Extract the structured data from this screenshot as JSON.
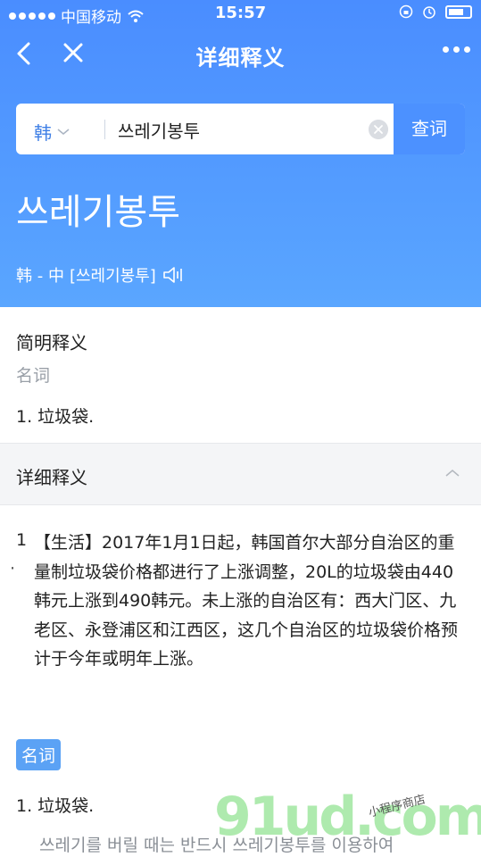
{
  "status_bar": {
    "carrier": "中国移动",
    "time": "15:57"
  },
  "navbar": {
    "title": "详细释义",
    "back_icon": "chevron-left-icon",
    "close_icon": "close-icon",
    "more_icon": "more-dots-icon"
  },
  "search": {
    "language": "韩",
    "query": "쓰레기봉투",
    "button_label": "查词"
  },
  "word": {
    "headword": "쓰레기봉투",
    "direction": "韩 - 中",
    "phonetic": "[쓰레기봉투]"
  },
  "brief": {
    "title": "简明释义",
    "pos": "名词",
    "definition": "1. 垃圾袋."
  },
  "detail": {
    "title": "详细释义",
    "entry_number": "1",
    "entry_bullet": "·",
    "entry_text": "【生活】2017年1月1日起，韩国首尔大部分自治区的重量制垃圾袋价格都进行了上涨调整，20L的垃圾袋由440韩元上涨到490韩元。未上涨的自治区有：西大门区、九老区、永登浦区和江西区，这几个自治区的垃圾袋价格预计于今年或明年上涨。",
    "pos_tag": "名词",
    "sense": "1.  垃圾袋.",
    "example": "쓰레기를 버릴 때는 반드시 쓰레기봉투를 이용하여"
  },
  "watermark": {
    "logo": "91ud.com",
    "tag": "小程序商店"
  },
  "colors": {
    "primary": "#4a8dff",
    "tag_blue": "#5ba2f5",
    "muted": "#9aa0a8"
  }
}
